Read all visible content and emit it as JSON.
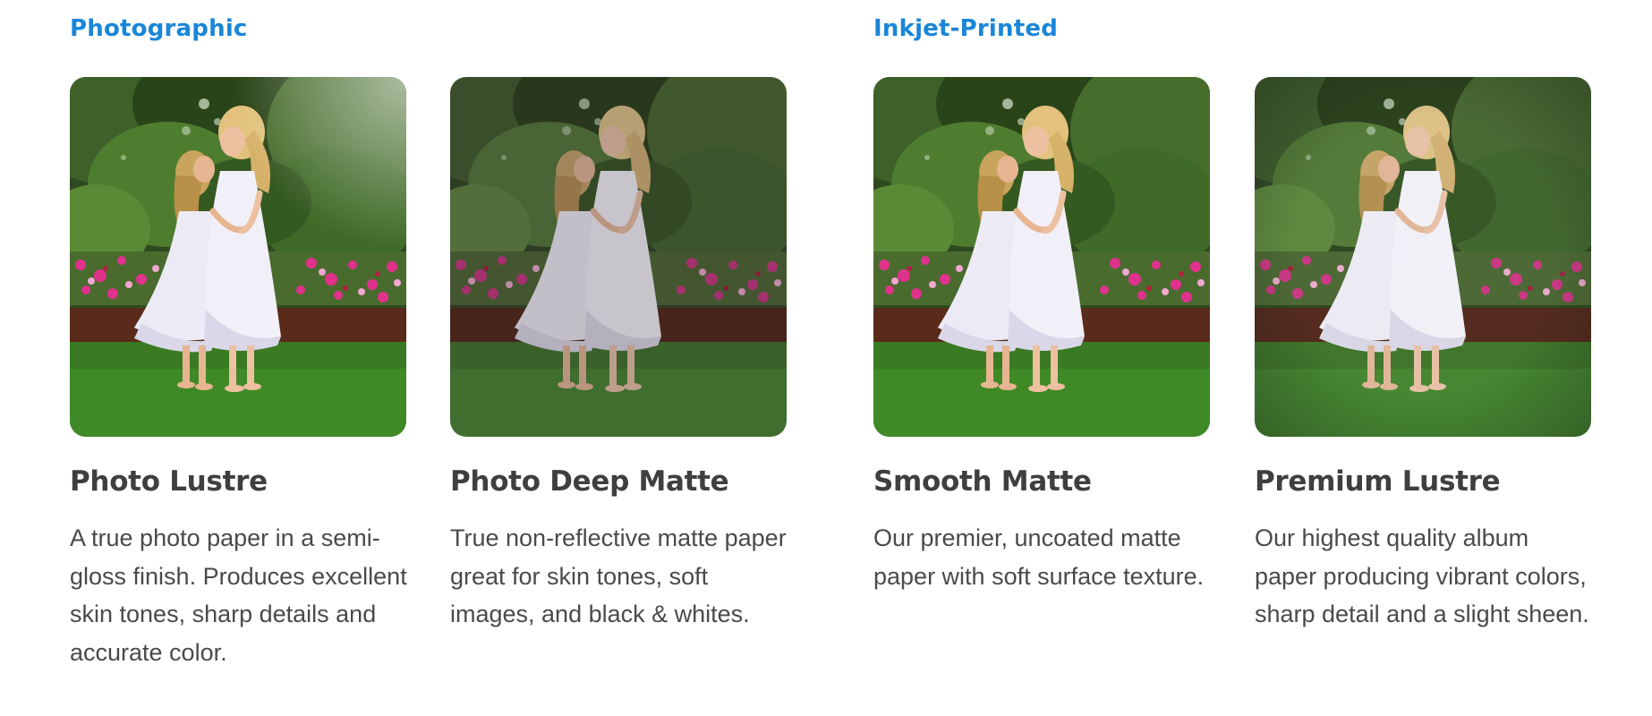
{
  "groups": [
    {
      "title": "Photographic"
    },
    {
      "title": "Inkjet-Printed"
    }
  ],
  "papers": [
    {
      "title": "Photo Lustre",
      "description": "A true photo paper in a semi-gloss finish. Produces excellent skin tones, sharp details and accurate color."
    },
    {
      "title": "Photo Deep Matte",
      "description": "True non-reflective matte paper great for skin tones, soft images, and black & whites."
    },
    {
      "title": "Smooth Matte",
      "description": "Our premier, uncoated matte paper with soft surface texture."
    },
    {
      "title": "Premium Lustre",
      "description": "Our highest quality album paper producing vibrant colors, sharp detail and a slight sheen."
    }
  ],
  "colors": {
    "accent": "#1a86d8",
    "heading": "#3f3f3f",
    "body_text": "#4a4a4a",
    "background": "#ffffff"
  }
}
